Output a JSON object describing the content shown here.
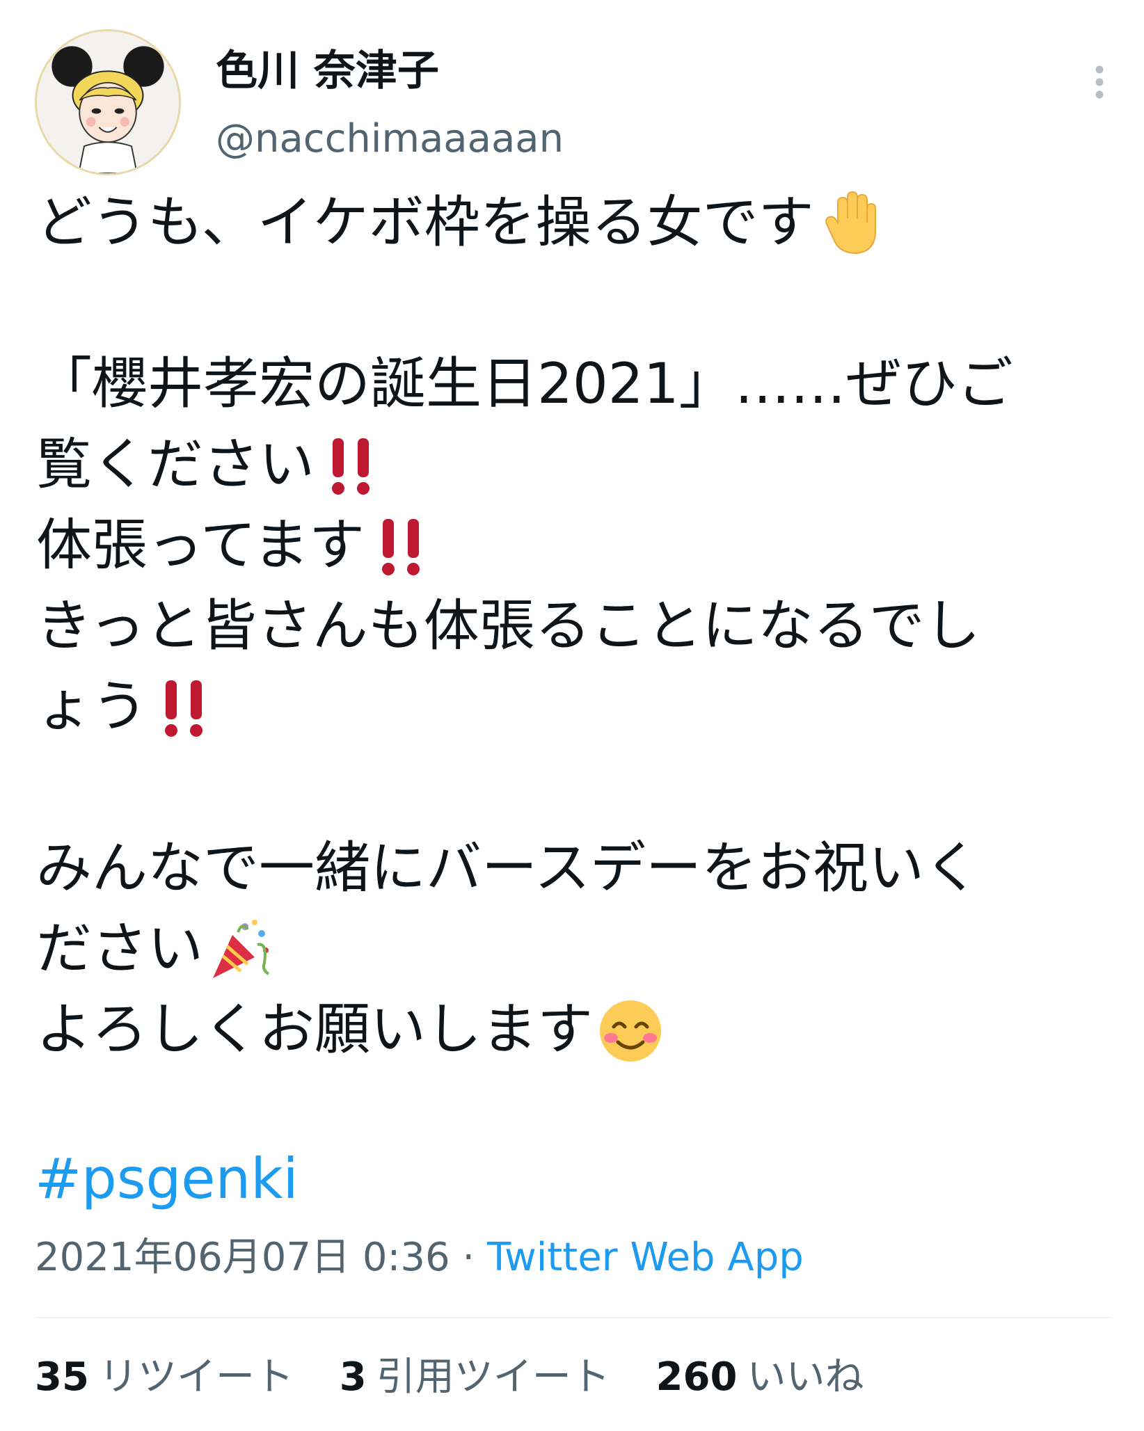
{
  "author": {
    "display_name": "色川 奈津子",
    "handle": "@nacchimaaaaan",
    "avatar_icon": "cartoon-girl-mouse-ears-avatar"
  },
  "menu": {
    "icon": "more-vertical-icon"
  },
  "tweet": {
    "lines": [
      {
        "text": "どうも、イケボ枠を操る女です",
        "emoji": "raised-hand-emoji"
      },
      {
        "text": "",
        "emoji": ""
      },
      {
        "text": "「櫻井孝宏の誕生日2021」……ぜひご",
        "emoji": ""
      },
      {
        "text": "覧ください",
        "emoji": "double-exclamation-emoji"
      },
      {
        "text": "体張ってます",
        "emoji": "double-exclamation-emoji"
      },
      {
        "text": "きっと皆さんも体張ることになるでし",
        "emoji": ""
      },
      {
        "text": "ょう",
        "emoji": "double-exclamation-emoji"
      },
      {
        "text": "",
        "emoji": ""
      },
      {
        "text": "みんなで一緒にバースデーをお祝いく",
        "emoji": ""
      },
      {
        "text": "ださい",
        "emoji": "party-popper-emoji"
      },
      {
        "text": "よろしくお願いします",
        "emoji": "smiling-face-emoji"
      }
    ],
    "hashtag": "#psgenki"
  },
  "meta": {
    "timestamp": "2021年06月07日 0:36",
    "separator": " · ",
    "source_app": "Twitter Web App"
  },
  "stats": {
    "retweets_count": "35",
    "retweets_label": "リツイート",
    "quotes_count": "3",
    "quotes_label": "引用ツイート",
    "likes_count": "260",
    "likes_label": "いいね"
  },
  "colors": {
    "link": "#1d9bf0",
    "secondary_text": "#536471",
    "primary_text": "#0f1419",
    "divider": "#eff3f4",
    "exclamation": "#be1931"
  }
}
